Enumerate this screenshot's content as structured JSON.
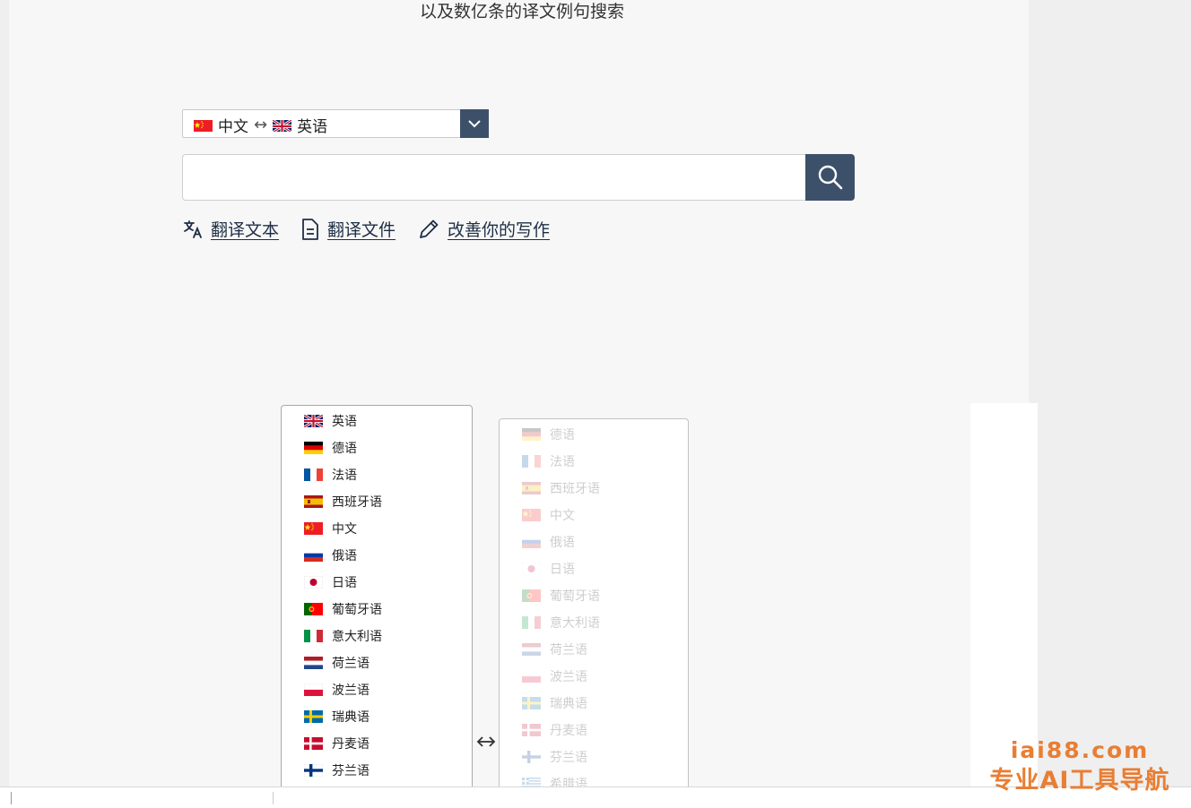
{
  "header": {
    "tagline": "以及数亿条的译文例句搜索"
  },
  "language_pair": {
    "source": "中文",
    "target": "英语",
    "source_flag": "cn",
    "target_flag": "gb",
    "swap_glyph": "↔"
  },
  "search": {
    "value": "",
    "placeholder": ""
  },
  "tools": [
    {
      "label": "翻译文本",
      "icon": "translate-icon"
    },
    {
      "label": "翻译文件",
      "icon": "document-icon"
    },
    {
      "label": "改善你的写作",
      "icon": "pencil-icon"
    }
  ],
  "source_languages": [
    {
      "label": "英语",
      "flag": "gb"
    },
    {
      "label": "德语",
      "flag": "de"
    },
    {
      "label": "法语",
      "flag": "fr"
    },
    {
      "label": "西班牙语",
      "flag": "es"
    },
    {
      "label": "中文",
      "flag": "cn"
    },
    {
      "label": "俄语",
      "flag": "ru"
    },
    {
      "label": "日语",
      "flag": "jp"
    },
    {
      "label": "葡萄牙语",
      "flag": "pt"
    },
    {
      "label": "意大利语",
      "flag": "it"
    },
    {
      "label": "荷兰语",
      "flag": "nl"
    },
    {
      "label": "波兰语",
      "flag": "pl"
    },
    {
      "label": "瑞典语",
      "flag": "se"
    },
    {
      "label": "丹麦语",
      "flag": "dk"
    },
    {
      "label": "芬兰语",
      "flag": "fi"
    }
  ],
  "target_languages": [
    {
      "label": "德语",
      "flag": "de"
    },
    {
      "label": "法语",
      "flag": "fr"
    },
    {
      "label": "西班牙语",
      "flag": "es"
    },
    {
      "label": "中文",
      "flag": "cn"
    },
    {
      "label": "俄语",
      "flag": "ru"
    },
    {
      "label": "日语",
      "flag": "jp"
    },
    {
      "label": "葡萄牙语",
      "flag": "pt"
    },
    {
      "label": "意大利语",
      "flag": "it"
    },
    {
      "label": "荷兰语",
      "flag": "nl"
    },
    {
      "label": "波兰语",
      "flag": "pl"
    },
    {
      "label": "瑞典语",
      "flag": "se"
    },
    {
      "label": "丹麦语",
      "flag": "dk"
    },
    {
      "label": "芬兰语",
      "flag": "fi"
    },
    {
      "label": "希腊语",
      "flag": "gr"
    }
  ],
  "watermark": {
    "line1": "iai88.com",
    "line2": "专业AI工具导航"
  },
  "colors": {
    "accent": "#3d5069",
    "watermark": "#e87e34",
    "link": "#1e2e45"
  }
}
